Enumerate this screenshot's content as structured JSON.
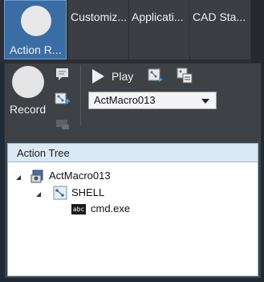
{
  "tabs": [
    {
      "label": "Action R...",
      "active": true
    },
    {
      "label": "Customiz..."
    },
    {
      "label": "Applicati..."
    },
    {
      "label": "CAD Sta..."
    }
  ],
  "toolbar": {
    "record_label": "Record",
    "play_label": "Play",
    "macro_selected": "ActMacro013"
  },
  "action_tree": {
    "header": "Action Tree",
    "root": "ActMacro013",
    "child": "SHELL",
    "leaf_icon_text": "abc",
    "leaf": "cmd.exe"
  },
  "colors": {
    "active_tab": "#3a6da3",
    "panel": "#3e4246",
    "tree_header": "#dbe8f5"
  },
  "icons": [
    "comment-icon",
    "add-macro-icon",
    "disabled-icon",
    "macro-run-icon",
    "macro-settings-icon",
    "macro-root-icon",
    "shell-icon",
    "abc-text-icon"
  ]
}
